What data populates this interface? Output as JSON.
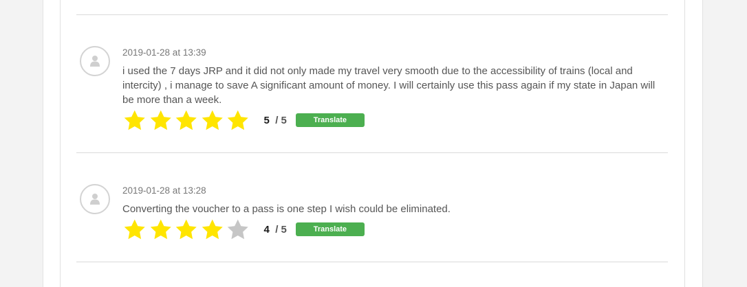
{
  "reviews": [
    {
      "date": "2019-01-28 at 13:39",
      "text": "i used the 7 days JRP and it did not only made my travel very smooth due to the accessibility of trains (local and intercity) , i manage to save A significant amount of money. I will certainly use this pass again if my state in Japan will be more than a week.",
      "rating": 5,
      "rating_value": "5",
      "rating_max": "/ 5",
      "translate_label": "Translate"
    },
    {
      "date": "2019-01-28 at 13:28",
      "text": "Converting the voucher to a pass is one step I wish could be eliminated.",
      "rating": 4,
      "rating_value": "4",
      "rating_max": "/ 5",
      "translate_label": "Translate"
    }
  ],
  "colors": {
    "star_filled": "#ffe500",
    "star_empty": "#c6c6c6",
    "translate_button": "#4caf50",
    "divider": "#d9d9d9"
  },
  "icons": {
    "avatar": "user-silhouette-icon",
    "star": "star-icon"
  }
}
